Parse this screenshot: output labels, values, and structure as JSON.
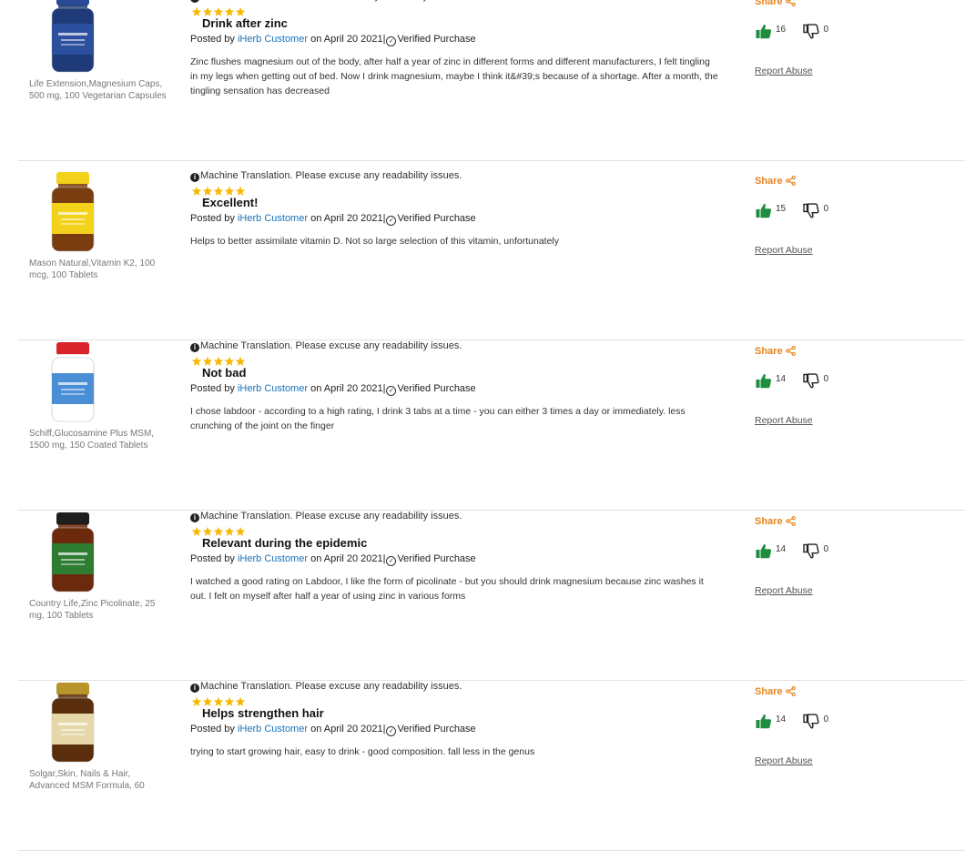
{
  "common": {
    "machine_translation": "Machine Translation. Please excuse any readability issues.",
    "posted_by": "Posted by",
    "author": "iHerb Customer",
    "date_text": "on April 20 2021",
    "separator": "|",
    "verified": "Verified Purchase",
    "share": "Share",
    "report": "Report Abuse",
    "rating": 5,
    "colors": {
      "accent": "#e5841e",
      "star": "#f5b700",
      "link": "#1a72b8",
      "thumb_up": "#1e8e3e"
    }
  },
  "reviews": [
    {
      "product": "Life Extension,Magnesium Caps, 500 mg, 100 Vegetarian Capsules",
      "title": "Drink after zinc",
      "text": "Zinc flushes magnesium out of the body, after half a year of zinc in different forms and different manufacturers, I felt tingling in my legs when getting out of bed. Now I drink magnesium, maybe I think it&#39;s because of a shortage. After a month, the tingling sensation has decreased",
      "helpful": "16",
      "unhelpful": "0",
      "bottle": {
        "body": "#1e3a78",
        "cap": "#2b4a96",
        "label": "#2c4f9e",
        "icon": "product-bottle-icon"
      }
    },
    {
      "product": "Mason Natural,Vitamin K2, 100 mcg, 100 Tablets",
      "title": "Excellent!",
      "text": "Helps to better assimilate vitamin D. Not so large selection of this vitamin, unfortunately",
      "helpful": "15",
      "unhelpful": "0",
      "bottle": {
        "body": "#7a3d10",
        "cap": "#f2d21b",
        "label": "#f2d21b",
        "icon": "product-bottle-icon"
      }
    },
    {
      "product": "Schiff,Glucosamine Plus MSM, 1500 mg, 150 Coated Tablets",
      "title": "Not bad",
      "text": "I chose labdoor - according to a high rating, I drink 3 tabs at a time - you can either 3 times a day or immediately. less crunching of the joint on the finger",
      "helpful": "14",
      "unhelpful": "0",
      "bottle": {
        "body": "#ffffff",
        "cap": "#d8232a",
        "label": "#4a8fd6",
        "icon": "product-bottle-icon"
      }
    },
    {
      "product": "Country Life,Zinc Picolinate, 25 mg, 100 Tablets",
      "title": "Relevant during the epidemic",
      "text": "I watched a good rating on Labdoor, I like the form of picolinate - but you should drink magnesium because zinc washes it out. I felt on myself after half a year of using zinc in various forms",
      "helpful": "14",
      "unhelpful": "0",
      "bottle": {
        "body": "#6b2a0c",
        "cap": "#1e1e1e",
        "label": "#2e7d32",
        "icon": "product-bottle-icon"
      }
    },
    {
      "product": "Solgar,Skin, Nails & Hair, Advanced MSM Formula, 60",
      "title": "Helps strengthen hair",
      "text": "trying to start growing hair, easy to drink - good composition. fall less in the genus",
      "helpful": "14",
      "unhelpful": "0",
      "bottle": {
        "body": "#5a2e0c",
        "cap": "#b8942c",
        "label": "#e6d7a8",
        "icon": "product-bottle-icon"
      }
    }
  ]
}
